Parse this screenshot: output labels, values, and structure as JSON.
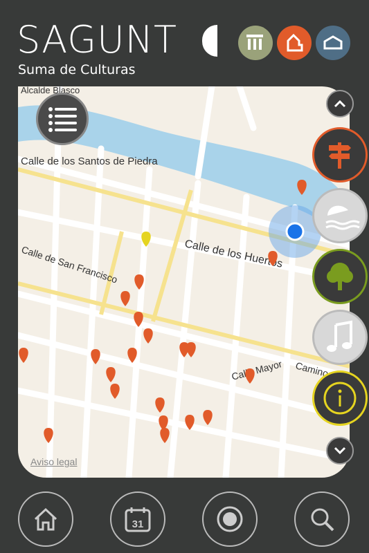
{
  "header": {
    "logo_text": "SAGUNT",
    "tagline": "Suma de Culturas"
  },
  "header_buttons": [
    {
      "name": "heritage",
      "color": "#9aa27a"
    },
    {
      "name": "culture",
      "color": "#e15b2a"
    },
    {
      "name": "tourism",
      "color": "#4f6e86"
    }
  ],
  "map": {
    "streets": [
      "Calle de los Santos de Piedra",
      "Calle de los Huertos",
      "Calle de San Francisco",
      "Calle Mayor",
      "Alcalde Blasco",
      "Camino"
    ],
    "legal_link": "Aviso legal"
  },
  "side_buttons": [
    {
      "name": "signpost",
      "color": "#e15b2a"
    },
    {
      "name": "beach",
      "color": "#c8c8c8"
    },
    {
      "name": "nature",
      "color": "#7a9c1f"
    },
    {
      "name": "music",
      "color": "#c8c8c8"
    },
    {
      "name": "info",
      "color": "#e5d420"
    }
  ],
  "bottom_nav": [
    {
      "name": "home"
    },
    {
      "name": "calendar",
      "day": "31"
    },
    {
      "name": "record"
    },
    {
      "name": "search"
    }
  ]
}
